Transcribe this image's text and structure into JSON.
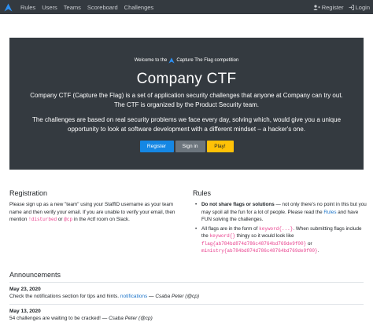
{
  "nav": {
    "links": [
      "Rules",
      "Users",
      "Teams",
      "Scoreboard",
      "Challenges"
    ],
    "register": "Register",
    "login": "Login"
  },
  "hero": {
    "welcome_prefix": "Welcome to the",
    "welcome_suffix": "Capture The Flag competition",
    "title": "Company CTF",
    "para1": "Company CTF (Capture the Flag) is a set of application security challenges that anyone at Company can try out. The CTF is organized by the Product Security team.",
    "para2": "The challenges are based on real security problems we face every day, solving which, would give you a unique opportunity to look at software development with a different mindset – a hacker's one.",
    "btn_register": "Register",
    "btn_signin": "Sign in",
    "btn_play": "Play!"
  },
  "registration": {
    "heading": "Registration",
    "text_before": "Please sign up as a new \"team\" using your StaffID username as your team name and then verify your email. If you are unable to verify your email, then mention ",
    "code1": "!disturbed",
    "text_or": " or ",
    "code2": "@cp",
    "text_after": " in the #ctf room on Slack."
  },
  "rules": {
    "heading": "Rules",
    "r1_bold": "Do not share flags or solutions",
    "r1_rest": " — not only there's no point in this but you may spoil all the fun for a lot of people. Please read the ",
    "r1_link": "Rules",
    "r1_end": " and have FUN solving the challenges.",
    "r2_a": "All flags are in the form of ",
    "r2_code1": "keyword{...}",
    "r2_b": ". When submitting flags include the ",
    "r2_code2": "keyword{}",
    "r2_c": " thingy so it would look like ",
    "r2_code3": "flag{ab784bd874d786c48764bd769de9f00}",
    "r2_d": " or ",
    "r2_code4": "ministry{ab784bd874d786c48764bd769de9f00}",
    "r2_e": "."
  },
  "announcements": {
    "heading": "Announcements",
    "items": [
      {
        "date": "May 23, 2020",
        "msg": "Check the notifications section for tips and hints. ",
        "link": "notifications",
        "sig": " — Csaba Peter (@cp)"
      },
      {
        "date": "May 13, 2020",
        "msg": "54 challenges are waiting to be cracked! ",
        "link": "",
        "sig": "— Csaba Peter (@cp)"
      }
    ]
  }
}
